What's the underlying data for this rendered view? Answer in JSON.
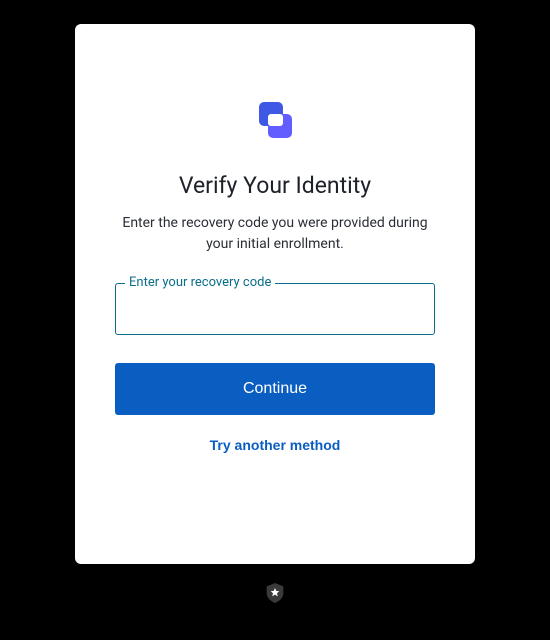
{
  "title": "Verify Your Identity",
  "subtitle": "Enter the recovery code you were provided during your initial enrollment.",
  "field": {
    "label": "Enter your recovery code",
    "value": ""
  },
  "buttons": {
    "continue": "Continue",
    "try_another": "Try another method"
  }
}
